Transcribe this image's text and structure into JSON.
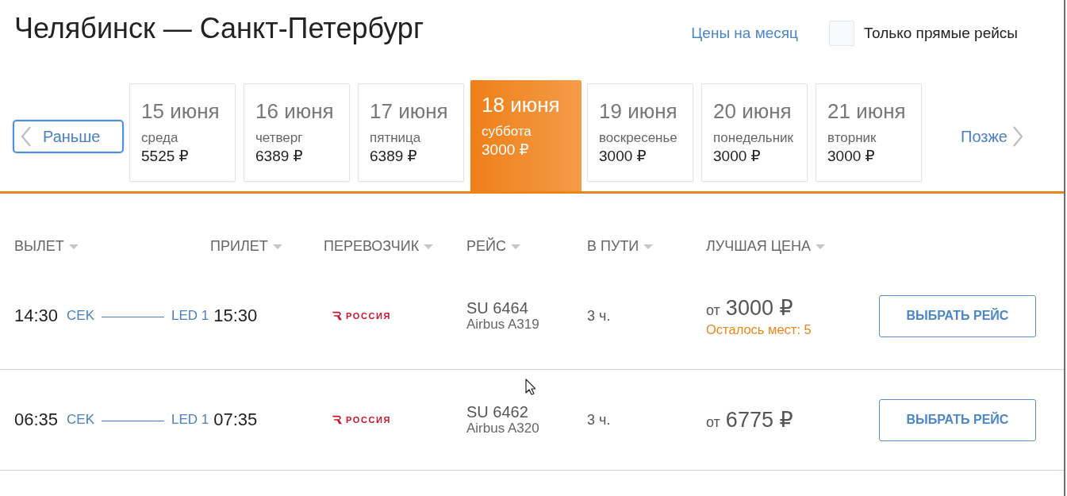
{
  "header": {
    "title": "Челябинск — Санкт-Петербург",
    "month_prices_link": "Цены на месяц",
    "direct_only": {
      "label": "Только прямые рейсы",
      "checked": false
    }
  },
  "date_bar": {
    "earlier": "Раньше",
    "later": "Позже",
    "dates": [
      {
        "date": "15 июня",
        "weekday": "среда",
        "price": "5525 ₽",
        "selected": false
      },
      {
        "date": "16 июня",
        "weekday": "четверг",
        "price": "6389 ₽",
        "selected": false
      },
      {
        "date": "17 июня",
        "weekday": "пятница",
        "price": "6389 ₽",
        "selected": false
      },
      {
        "date": "18 июня",
        "weekday": "суббота",
        "price": "3000 ₽",
        "selected": true
      },
      {
        "date": "19 июня",
        "weekday": "воскресенье",
        "price": "3000 ₽",
        "selected": false
      },
      {
        "date": "20 июня",
        "weekday": "понедельник",
        "price": "3000 ₽",
        "selected": false
      },
      {
        "date": "21 июня",
        "weekday": "вторник",
        "price": "3000 ₽",
        "selected": false
      }
    ]
  },
  "table": {
    "columns": [
      "ВЫЛЕТ",
      "ПРИЛЕТ",
      "ПЕРЕВОЗЧИК",
      "РЕЙС",
      "В ПУТИ",
      "ЛУЧШАЯ ЦЕНА"
    ],
    "rows": [
      {
        "departure_time": "14:30",
        "origin": "CEK",
        "destination": "LED 1",
        "arrival_time": "15:30",
        "carrier": "РОССИЯ",
        "flight": "SU 6464",
        "aircraft": "Airbus A319",
        "duration": "3 ч.",
        "price_prefix": "от",
        "price": "3000 ₽",
        "seats_left": "Осталось мест: 5",
        "button": "ВЫБРАТЬ РЕЙС"
      },
      {
        "departure_time": "06:35",
        "origin": "CEK",
        "destination": "LED 1",
        "arrival_time": "07:35",
        "carrier": "РОССИЯ",
        "flight": "SU 6462",
        "aircraft": "Airbus A320",
        "duration": "3 ч.",
        "price_prefix": "от",
        "price": "6775 ₽",
        "button": "ВЫБРАТЬ РЕЙС"
      }
    ]
  }
}
